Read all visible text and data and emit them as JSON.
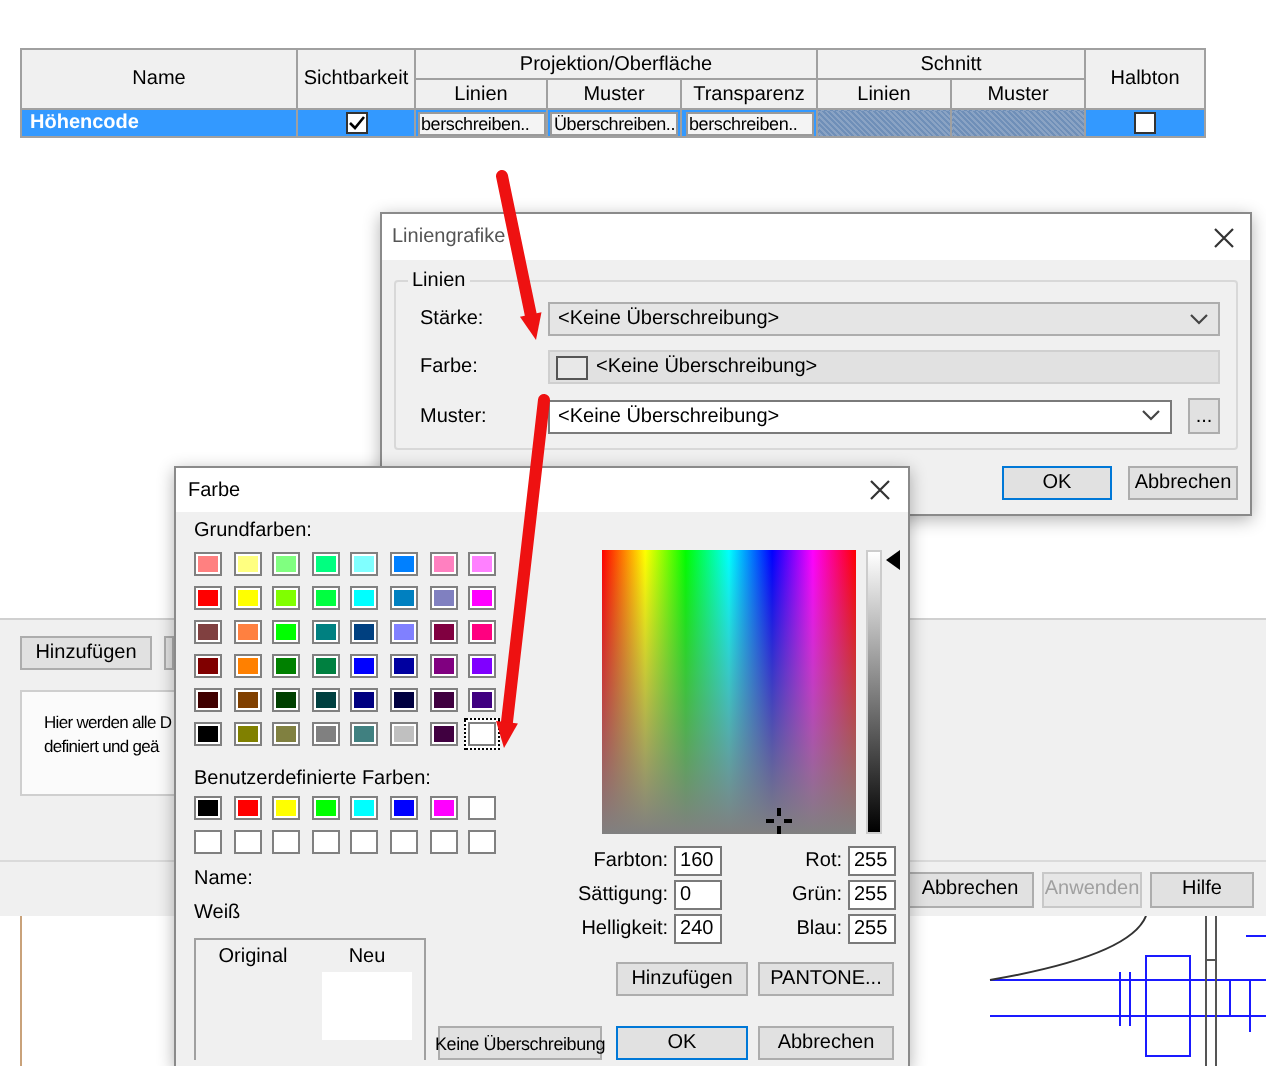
{
  "background_dialog": {
    "table": {
      "header_groups": [
        "Projektion/Oberfläche",
        "Schnitt"
      ],
      "columns": [
        "Name",
        "Sichtbarkeit",
        "Linien",
        "Muster",
        "Transparenz",
        "Linien",
        "Muster",
        "Halbton"
      ],
      "rows": [
        {
          "name": "Höhencode",
          "selected": true,
          "visible": true,
          "overrides": [
            "berschreiben..",
            "Überschreiben..",
            "berschreiben.."
          ],
          "halftone": false
        }
      ]
    },
    "side_buttons": [
      "Hinzufügen"
    ],
    "description_lines": [
      "Hier werden alle D",
      "definiert und geä"
    ],
    "buttons": [
      {
        "label": "Abbrechen",
        "disabled": false
      },
      {
        "label": "Anwenden",
        "disabled": true
      },
      {
        "label": "Hilfe",
        "disabled": false
      }
    ]
  },
  "line_graphics_dialog": {
    "title": "Liniengrafike",
    "group_label": "Linien",
    "rows": [
      {
        "kind": "dropdown",
        "label": "Stärke:",
        "value": "<Keine Überschreibung>"
      },
      {
        "kind": "color",
        "label": "Farbe:",
        "value": "<Keine Überschreibung>"
      },
      {
        "kind": "dropdown_browse",
        "label": "Muster:",
        "value": "<Keine Überschreibung>",
        "button": "..."
      }
    ],
    "buttons": [
      {
        "label": "OK",
        "default": true
      },
      {
        "label": "Abbrechen",
        "default": false
      }
    ]
  },
  "color_dialog": {
    "title": "Farbe",
    "basic_label": "Grundfarben:",
    "basic_colors": [
      {
        "color": "#ff8080",
        "selected": false
      },
      {
        "color": "#ffff80",
        "selected": false
      },
      {
        "color": "#80ff80",
        "selected": false
      },
      {
        "color": "#00ff80",
        "selected": false
      },
      {
        "color": "#80ffff",
        "selected": false
      },
      {
        "color": "#0080ff",
        "selected": false
      },
      {
        "color": "#ff80c0",
        "selected": false
      },
      {
        "color": "#ff80ff",
        "selected": false
      },
      {
        "color": "#ff0000",
        "selected": false
      },
      {
        "color": "#ffff00",
        "selected": false
      },
      {
        "color": "#80ff00",
        "selected": false
      },
      {
        "color": "#00ff40",
        "selected": false
      },
      {
        "color": "#00ffff",
        "selected": false
      },
      {
        "color": "#0080c0",
        "selected": false
      },
      {
        "color": "#8080c0",
        "selected": false
      },
      {
        "color": "#ff00ff",
        "selected": false
      },
      {
        "color": "#804040",
        "selected": false
      },
      {
        "color": "#ff8040",
        "selected": false
      },
      {
        "color": "#00ff00",
        "selected": false
      },
      {
        "color": "#008080",
        "selected": false
      },
      {
        "color": "#004080",
        "selected": false
      },
      {
        "color": "#8080ff",
        "selected": false
      },
      {
        "color": "#800040",
        "selected": false
      },
      {
        "color": "#ff0080",
        "selected": false
      },
      {
        "color": "#800000",
        "selected": false
      },
      {
        "color": "#ff8000",
        "selected": false
      },
      {
        "color": "#008000",
        "selected": false
      },
      {
        "color": "#008040",
        "selected": false
      },
      {
        "color": "#0000ff",
        "selected": false
      },
      {
        "color": "#0000a0",
        "selected": false
      },
      {
        "color": "#800080",
        "selected": false
      },
      {
        "color": "#8000ff",
        "selected": false
      },
      {
        "color": "#400000",
        "selected": false
      },
      {
        "color": "#804000",
        "selected": false
      },
      {
        "color": "#004000",
        "selected": false
      },
      {
        "color": "#004040",
        "selected": false
      },
      {
        "color": "#000080",
        "selected": false
      },
      {
        "color": "#000040",
        "selected": false
      },
      {
        "color": "#400040",
        "selected": false
      },
      {
        "color": "#400080",
        "selected": false
      },
      {
        "color": "#000000",
        "selected": false
      },
      {
        "color": "#808000",
        "selected": false
      },
      {
        "color": "#808040",
        "selected": false
      },
      {
        "color": "#808080",
        "selected": false
      },
      {
        "color": "#408080",
        "selected": false
      },
      {
        "color": "#c0c0c0",
        "selected": false
      },
      {
        "color": "#400040",
        "selected": false
      },
      {
        "color": "#ffffff",
        "selected": true
      }
    ],
    "custom_label": "Benutzerdefinierte Farben:",
    "custom_colors": [
      {
        "color": "#000000"
      },
      {
        "color": "#ff0000"
      },
      {
        "color": "#ffff00"
      },
      {
        "color": "#00ff00"
      },
      {
        "color": "#00ffff"
      },
      {
        "color": "#0000ff"
      },
      {
        "color": "#ff00ff"
      },
      {
        "color": "#ffffff"
      },
      {
        "color": "#ffffff"
      },
      {
        "color": "#ffffff"
      },
      {
        "color": "#ffffff"
      },
      {
        "color": "#ffffff"
      },
      {
        "color": "#ffffff"
      },
      {
        "color": "#ffffff"
      },
      {
        "color": "#ffffff"
      },
      {
        "color": "#ffffff"
      }
    ],
    "name_label": "Name:",
    "name_value": "Weiß",
    "preview": {
      "original_label": "Original",
      "new_label": "Neu"
    },
    "hsl_fields": [
      {
        "label": "Farbton:",
        "value": "160"
      },
      {
        "label": "Sättigung:",
        "value": "0"
      },
      {
        "label": "Helligkeit:",
        "value": "240"
      }
    ],
    "rgb_fields": [
      {
        "label": "Rot:",
        "value": "255"
      },
      {
        "label": "Grün:",
        "value": "255"
      },
      {
        "label": "Blau:",
        "value": "255"
      }
    ],
    "side_buttons": [
      "Hinzufügen",
      "PANTONE..."
    ],
    "buttons": [
      {
        "label": "Keine Überschreibung",
        "default": false
      },
      {
        "label": "OK",
        "default": true
      },
      {
        "label": "Abbrechen",
        "default": false
      }
    ]
  }
}
